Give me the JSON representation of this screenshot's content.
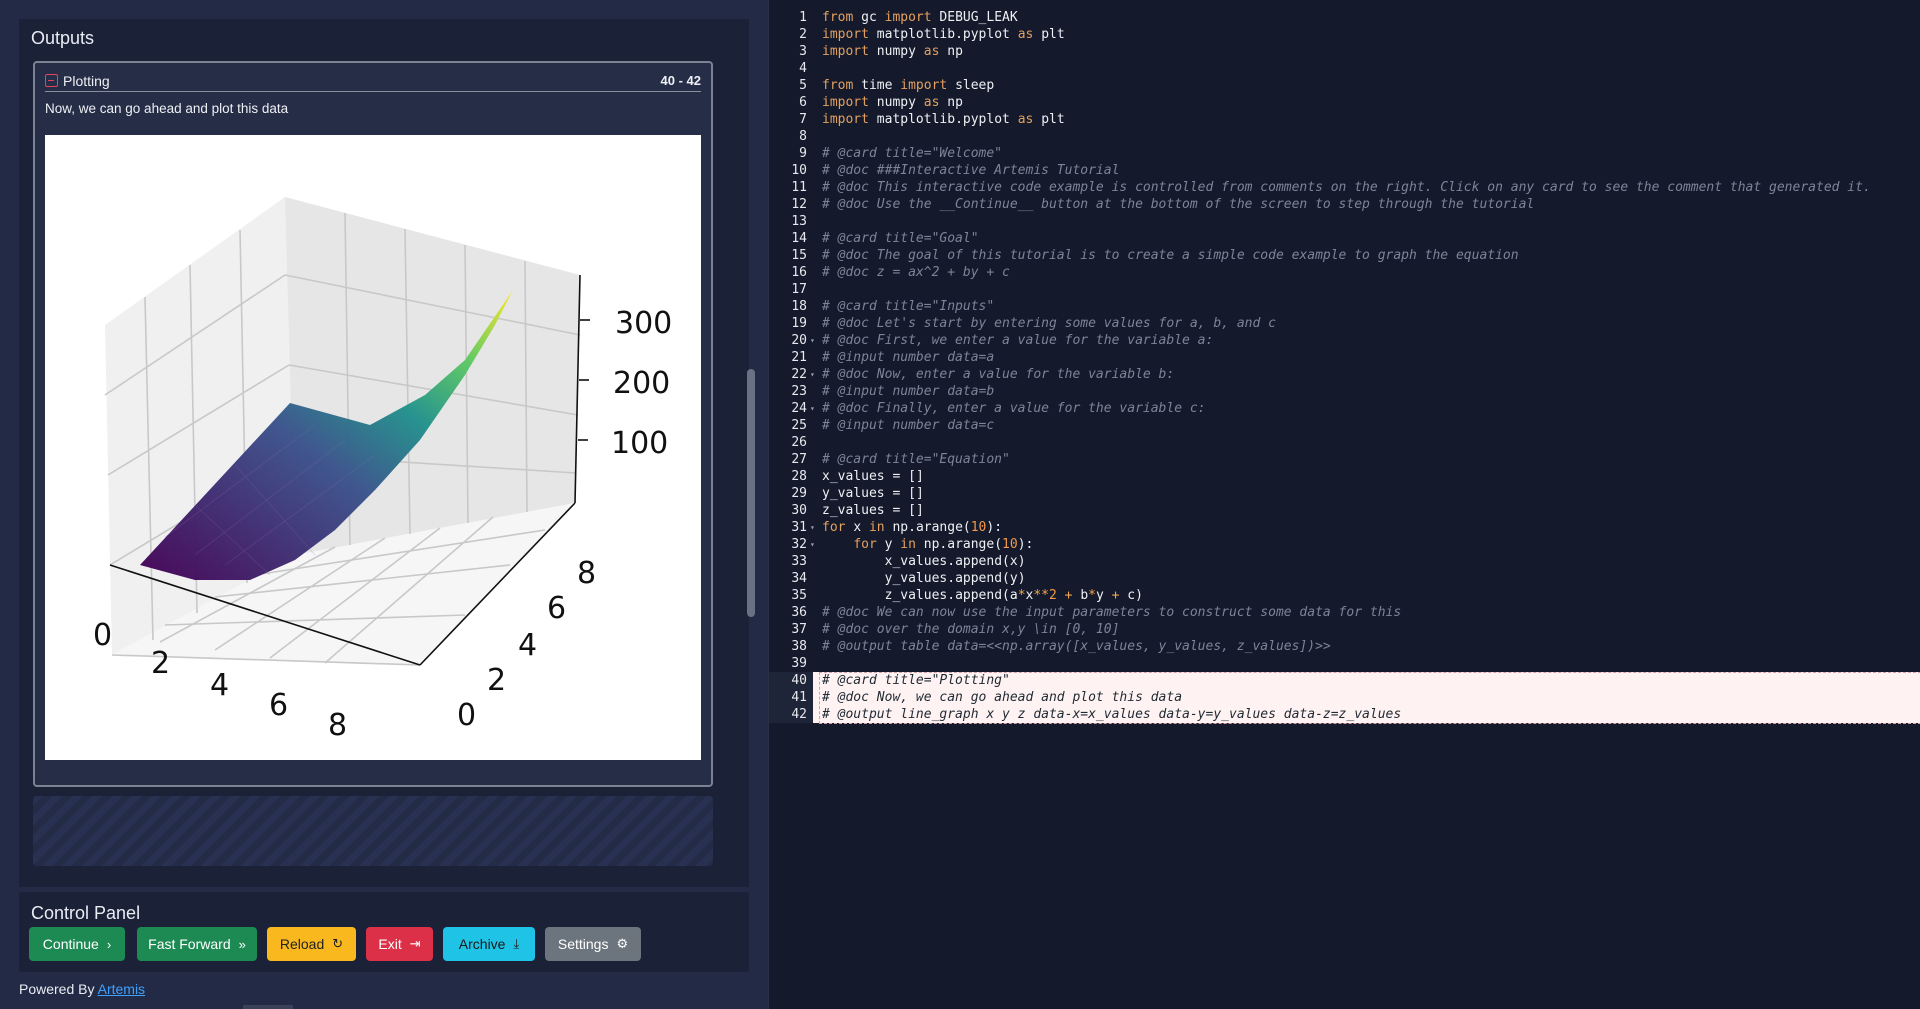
{
  "outputs": {
    "title": "Outputs",
    "card": {
      "title": "Plotting",
      "range": "40 - 42",
      "doc": "Now, we can go ahead and plot this data",
      "plot": {
        "z_ticks": [
          "300",
          "200",
          "100"
        ],
        "x_ticks": [
          "0",
          "2",
          "4",
          "6",
          "8"
        ],
        "y_ticks": [
          "0",
          "2",
          "4",
          "6",
          "8"
        ],
        "colormap": [
          "#440154",
          "#3b528b",
          "#21918c",
          "#5ec962",
          "#fde725"
        ]
      }
    }
  },
  "control_panel": {
    "title": "Control Panel",
    "buttons": [
      {
        "label": "Continue",
        "icon": "chevron-right-icon"
      },
      {
        "label": "Fast Forward",
        "icon": "double-chevron-right-icon"
      },
      {
        "label": "Reload",
        "icon": "reload-icon"
      },
      {
        "label": "Exit",
        "icon": "exit-icon"
      },
      {
        "label": "Archive",
        "icon": "download-icon"
      },
      {
        "label": "Settings",
        "icon": "gear-icon"
      }
    ]
  },
  "footer": {
    "powered_by": "Powered By ",
    "link": "Artemis"
  },
  "editor": {
    "highlight_lines": [
      40,
      41,
      42
    ],
    "fold_lines": [
      20,
      22,
      24,
      31,
      32
    ],
    "lines": [
      {
        "n": "1",
        "text": "from gc import DEBUG_LEAK"
      },
      {
        "n": "2",
        "text": "import matplotlib.pyplot as plt"
      },
      {
        "n": "3",
        "text": "import numpy as np"
      },
      {
        "n": "4",
        "text": ""
      },
      {
        "n": "5",
        "text": "from time import sleep"
      },
      {
        "n": "6",
        "text": "import numpy as np"
      },
      {
        "n": "7",
        "text": "import matplotlib.pyplot as plt"
      },
      {
        "n": "8",
        "text": ""
      },
      {
        "n": "9",
        "text": "# @card title=\"Welcome\""
      },
      {
        "n": "10",
        "text": "# @doc ###Interactive Artemis Tutorial"
      },
      {
        "n": "11",
        "text": "# @doc This interactive code example is controlled from comments on the right. Click on any card to see the comment that generated it."
      },
      {
        "n": "12",
        "text": "# @doc Use the __Continue__ button at the bottom of the screen to step through the tutorial"
      },
      {
        "n": "13",
        "text": ""
      },
      {
        "n": "14",
        "text": "# @card title=\"Goal\""
      },
      {
        "n": "15",
        "text": "# @doc The goal of this tutorial is to create a simple code example to graph the equation"
      },
      {
        "n": "16",
        "text": "# @doc z = ax^2 + by + c"
      },
      {
        "n": "17",
        "text": ""
      },
      {
        "n": "18",
        "text": "# @card title=\"Inputs\""
      },
      {
        "n": "19",
        "text": "# @doc Let's start by entering some values for a, b, and c"
      },
      {
        "n": "20",
        "text": "# @doc First, we enter a value for the variable a:"
      },
      {
        "n": "21",
        "text": "# @input number data=a"
      },
      {
        "n": "22",
        "text": "# @doc Now, enter a value for the variable b:"
      },
      {
        "n": "23",
        "text": "# @input number data=b"
      },
      {
        "n": "24",
        "text": "# @doc Finally, enter a value for the variable c:"
      },
      {
        "n": "25",
        "text": "# @input number data=c"
      },
      {
        "n": "26",
        "text": ""
      },
      {
        "n": "27",
        "text": "# @card title=\"Equation\""
      },
      {
        "n": "28",
        "text": "x_values = []"
      },
      {
        "n": "29",
        "text": "y_values = []"
      },
      {
        "n": "30",
        "text": "z_values = []"
      },
      {
        "n": "31",
        "text": "for x in np.arange(10):"
      },
      {
        "n": "32",
        "text": "    for y in np.arange(10):"
      },
      {
        "n": "33",
        "text": "        x_values.append(x)"
      },
      {
        "n": "34",
        "text": "        y_values.append(y)"
      },
      {
        "n": "35",
        "text": "        z_values.append(a*x**2 + b*y + c)"
      },
      {
        "n": "36",
        "text": "# @doc We can now use the input parameters to construct some data for this"
      },
      {
        "n": "37",
        "text": "# @doc over the domain x,y \\in [0, 10]"
      },
      {
        "n": "38",
        "text": "# @output table data=<<np.array([x_values, y_values, z_values])>>"
      },
      {
        "n": "39",
        "text": ""
      },
      {
        "n": "40",
        "text": "# @card title=\"Plotting\""
      },
      {
        "n": "41",
        "text": "# @doc Now, we can go ahead and plot this data"
      },
      {
        "n": "42",
        "text": "# @output line_graph x y z data-x=x_values data-y=y_values data-z=z_values"
      }
    ]
  }
}
